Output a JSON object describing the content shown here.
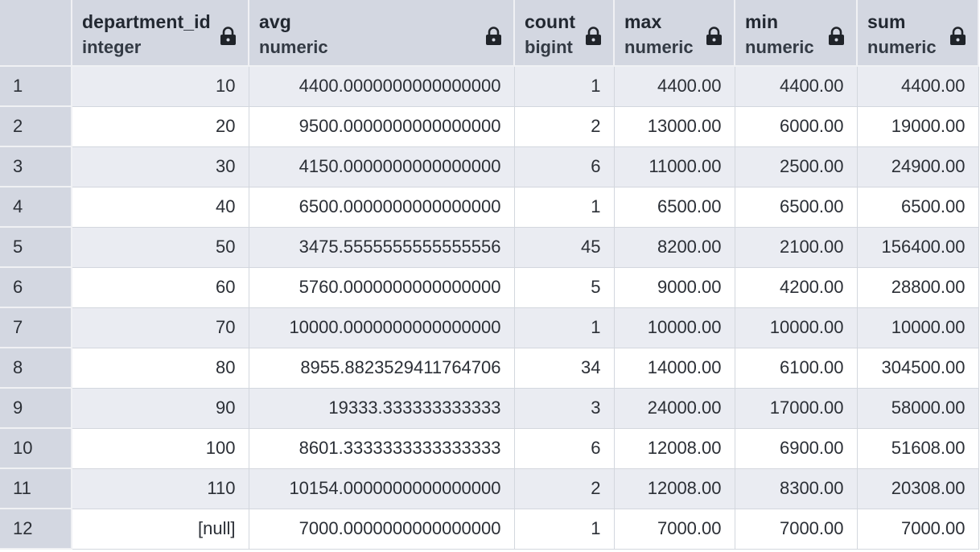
{
  "columns": [
    {
      "name": "department_id",
      "type": "integer",
      "icon": "lock-icon"
    },
    {
      "name": "avg",
      "type": "numeric",
      "icon": "lock-icon"
    },
    {
      "name": "count",
      "type": "bigint",
      "icon": "lock-icon"
    },
    {
      "name": "max",
      "type": "numeric",
      "icon": "lock-icon"
    },
    {
      "name": "min",
      "type": "numeric",
      "icon": "lock-icon"
    },
    {
      "name": "sum",
      "type": "numeric",
      "icon": "lock-icon"
    }
  ],
  "rows": [
    {
      "n": "1",
      "cells": [
        "10",
        "4400.0000000000000000",
        "1",
        "4400.00",
        "4400.00",
        "4400.00"
      ]
    },
    {
      "n": "2",
      "cells": [
        "20",
        "9500.0000000000000000",
        "2",
        "13000.00",
        "6000.00",
        "19000.00"
      ]
    },
    {
      "n": "3",
      "cells": [
        "30",
        "4150.0000000000000000",
        "6",
        "11000.00",
        "2500.00",
        "24900.00"
      ]
    },
    {
      "n": "4",
      "cells": [
        "40",
        "6500.0000000000000000",
        "1",
        "6500.00",
        "6500.00",
        "6500.00"
      ]
    },
    {
      "n": "5",
      "cells": [
        "50",
        "3475.5555555555555556",
        "45",
        "8200.00",
        "2100.00",
        "156400.00"
      ]
    },
    {
      "n": "6",
      "cells": [
        "60",
        "5760.0000000000000000",
        "5",
        "9000.00",
        "4200.00",
        "28800.00"
      ]
    },
    {
      "n": "7",
      "cells": [
        "70",
        "10000.0000000000000000",
        "1",
        "10000.00",
        "10000.00",
        "10000.00"
      ]
    },
    {
      "n": "8",
      "cells": [
        "80",
        "8955.8823529411764706",
        "34",
        "14000.00",
        "6100.00",
        "304500.00"
      ]
    },
    {
      "n": "9",
      "cells": [
        "90",
        "19333.333333333333",
        "3",
        "24000.00",
        "17000.00",
        "58000.00"
      ]
    },
    {
      "n": "10",
      "cells": [
        "100",
        "8601.3333333333333333",
        "6",
        "12008.00",
        "6900.00",
        "51608.00"
      ]
    },
    {
      "n": "11",
      "cells": [
        "110",
        "10154.0000000000000000",
        "2",
        "12008.00",
        "8300.00",
        "20308.00"
      ]
    },
    {
      "n": "12",
      "cells": [
        "[null]",
        "7000.0000000000000000",
        "1",
        "7000.00",
        "7000.00",
        "7000.00"
      ]
    }
  ],
  "colors": {
    "header_bg": "#d3d7e1",
    "row_odd_bg": "#eaecf2",
    "row_even_bg": "#ffffff",
    "lock_icon": "#1f2329"
  }
}
